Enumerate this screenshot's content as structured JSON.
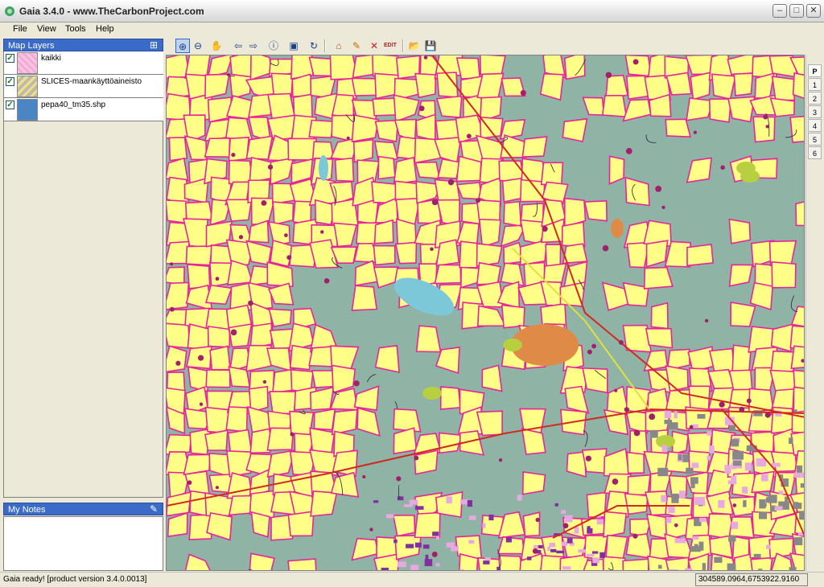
{
  "window": {
    "title": "Gaia 3.4.0 - www.TheCarbonProject.com"
  },
  "menu": {
    "items": [
      "File",
      "View",
      "Tools",
      "Help"
    ]
  },
  "layers_panel": {
    "title": "Map Layers",
    "layers": [
      {
        "name": "kaikki",
        "checked": true,
        "swatch_color": "#f5b8dc"
      },
      {
        "name": "SLICES-maankäyttöaineisto",
        "checked": true,
        "swatch_color": "#cfd88a"
      },
      {
        "name": "pepa40_tm35.shp",
        "checked": true,
        "swatch_color": "#4a86c4"
      }
    ]
  },
  "notes_panel": {
    "title": "My Notes"
  },
  "toolbar": {
    "tools": [
      "zoom-in",
      "zoom-out",
      "pan",
      "back",
      "forward",
      "info",
      "full-extent",
      "refresh",
      "edit-tag",
      "edit-pencil",
      "delete",
      "edit-text",
      "open",
      "save"
    ],
    "edit_label": "EDIT"
  },
  "page_tabs": [
    "P",
    "1",
    "2",
    "3",
    "4",
    "5",
    "6"
  ],
  "status": {
    "message": "Gaia ready! [product version 3.4.0.0013]",
    "coords": "304589.0964,6753922.9160"
  },
  "colors": {
    "map_background": "#8fb3a5",
    "fields": "#ffff88",
    "roads": "#e8249a",
    "water": "#7cc8d8",
    "urban": "#e8a8e0",
    "panel_header": "#3a6bc8"
  }
}
